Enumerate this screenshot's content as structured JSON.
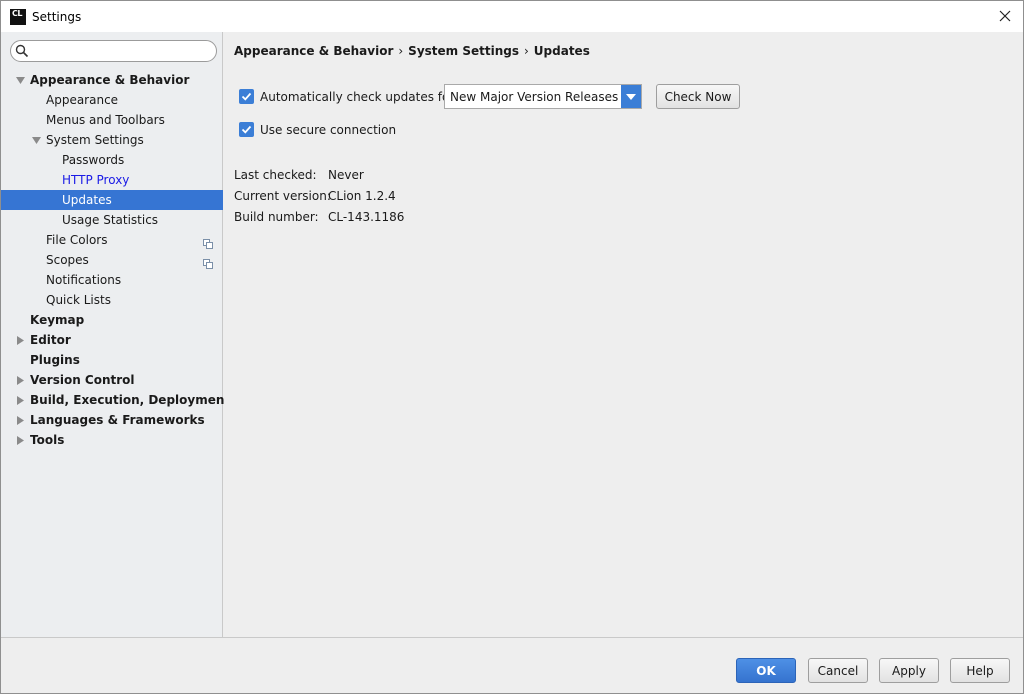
{
  "window": {
    "title": "Settings",
    "app_icon_text": "CL"
  },
  "search": {
    "placeholder": ""
  },
  "tree": [
    {
      "label": "Appearance & Behavior",
      "level": 0,
      "bold": true,
      "arrow": "down"
    },
    {
      "label": "Appearance",
      "level": 1
    },
    {
      "label": "Menus and Toolbars",
      "level": 1
    },
    {
      "label": "System Settings",
      "level": 1,
      "arrow": "down"
    },
    {
      "label": "Passwords",
      "level": 2
    },
    {
      "label": "HTTP Proxy",
      "level": 2,
      "link": true
    },
    {
      "label": "Updates",
      "level": 2,
      "selected": true
    },
    {
      "label": "Usage Statistics",
      "level": 2
    },
    {
      "label": "File Colors",
      "level": 1,
      "copy_icon": true
    },
    {
      "label": "Scopes",
      "level": 1,
      "copy_icon": true
    },
    {
      "label": "Notifications",
      "level": 1
    },
    {
      "label": "Quick Lists",
      "level": 1
    },
    {
      "label": "Keymap",
      "level": 0,
      "bold": true
    },
    {
      "label": "Editor",
      "level": 0,
      "bold": true,
      "arrow": "right"
    },
    {
      "label": "Plugins",
      "level": 0,
      "bold": true
    },
    {
      "label": "Version Control",
      "level": 0,
      "bold": true,
      "arrow": "right"
    },
    {
      "label": "Build, Execution, Deployment",
      "level": 0,
      "bold": true,
      "arrow": "right"
    },
    {
      "label": "Languages & Frameworks",
      "level": 0,
      "bold": true,
      "arrow": "right"
    },
    {
      "label": "Tools",
      "level": 0,
      "bold": true,
      "arrow": "right"
    }
  ],
  "breadcrumb": [
    "Appearance & Behavior",
    "System Settings",
    "Updates"
  ],
  "breadcrumb_sep": "›",
  "updates": {
    "auto_check_label": "Automatically check updates for",
    "auto_check_checked": true,
    "channel_selected": "New Major Version Releases",
    "check_now_label": "Check Now",
    "secure_label": "Use secure connection",
    "secure_checked": true
  },
  "info": {
    "last_checked_label": "Last checked:",
    "last_checked_value": "Never",
    "current_version_label": "Current version:",
    "current_version_value": "CLion 1.2.4",
    "build_number_label": "Build number:",
    "build_number_value": "CL-143.1186"
  },
  "footer": {
    "ok": "OK",
    "cancel": "Cancel",
    "apply": "Apply",
    "help": "Help"
  },
  "colors": {
    "accent": "#3675d3",
    "link": "#1a1ae6",
    "sidebar_bg": "#eceef0",
    "content_bg": "#eeeeee"
  }
}
